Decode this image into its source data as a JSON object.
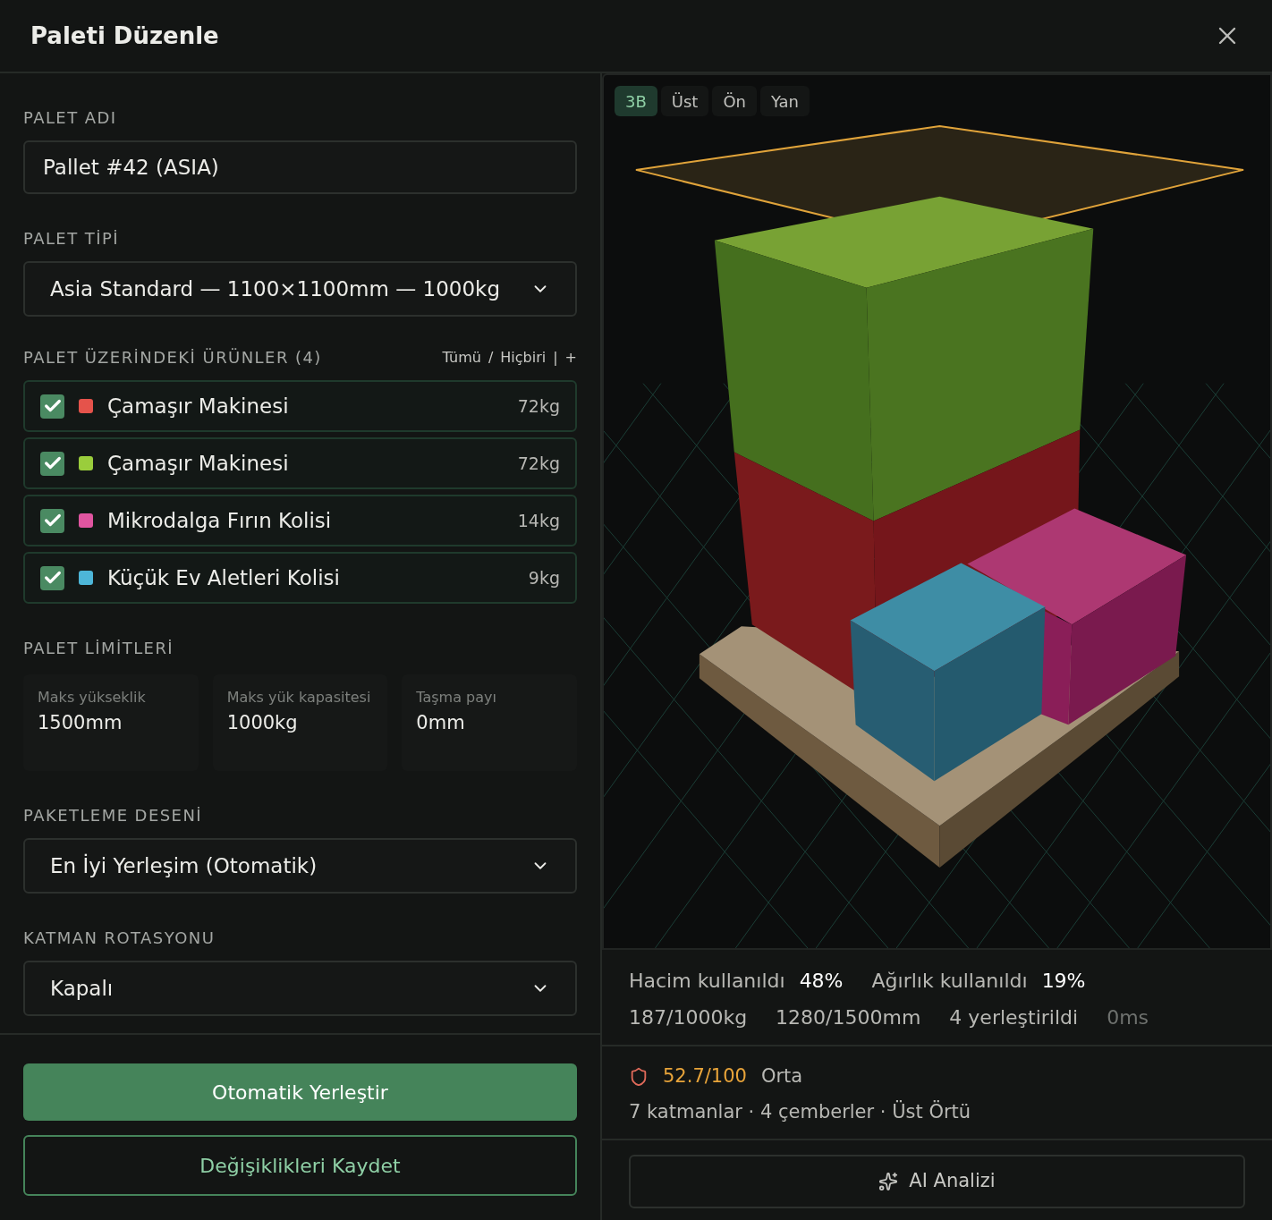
{
  "dialog": {
    "title": "Paleti Düzenle"
  },
  "pallet_name": {
    "label": "PALET ADI",
    "value": "Pallet #42 (ASIA)"
  },
  "pallet_type": {
    "label": "PALET TİPİ",
    "value": "Asia Standard — 1100×1100mm — 1000kg"
  },
  "products": {
    "label": "PALET ÜZERİNDEKİ ÜRÜNLER (4)",
    "actions": [
      "Tümü",
      "/",
      "Hiçbiri",
      "|",
      "+"
    ],
    "items": [
      {
        "name": "Çamaşır Makinesi",
        "weight": "72kg",
        "checked": true,
        "color": "#e5534b"
      },
      {
        "name": "Çamaşır Makinesi",
        "weight": "72kg",
        "checked": true,
        "color": "#9acd3c"
      },
      {
        "name": "Mikrodalga Fırın Kolisi",
        "weight": "14kg",
        "checked": true,
        "color": "#e055a0"
      },
      {
        "name": "Küçük Ev Aletleri Kolisi",
        "weight": "9kg",
        "checked": true,
        "color": "#4db6d8"
      }
    ]
  },
  "limits": {
    "label": "PALET LİMİTLERİ",
    "cards": [
      {
        "label": "Maks yükseklik",
        "value": "1500mm"
      },
      {
        "label": "Maks yük kapasitesi",
        "value": "1000kg"
      },
      {
        "label": "Taşma payı",
        "value": "0mm"
      }
    ]
  },
  "packing_pattern": {
    "label": "PAKETLEME DESENİ",
    "value": "En İyi Yerleşim (Otomatik)"
  },
  "layer_rotation": {
    "label": "KATMAN ROTASYONU",
    "value": "Kapalı"
  },
  "buttons": {
    "auto_place": "Otomatik Yerleştir",
    "save": "Değişiklikleri Kaydet"
  },
  "view_tabs": [
    {
      "label": "3B",
      "selected": true
    },
    {
      "label": "Üst",
      "selected": false
    },
    {
      "label": "Ön",
      "selected": false
    },
    {
      "label": "Yan",
      "selected": false
    }
  ],
  "stats": {
    "row1": [
      {
        "label": "Hacim kullanıldı",
        "value": "48%"
      },
      {
        "label": "Ağırlık kullanıldı",
        "value": "19%"
      }
    ],
    "row2": [
      "187/1000kg",
      "1280/1500mm",
      "4 yerleştirildi"
    ],
    "time": "0ms"
  },
  "score": {
    "value": "52.7/100",
    "rating": "Orta",
    "details": "7 katmanlar · 4 çemberler · Üst Örtü"
  },
  "ai_button": "AI Analizi"
}
